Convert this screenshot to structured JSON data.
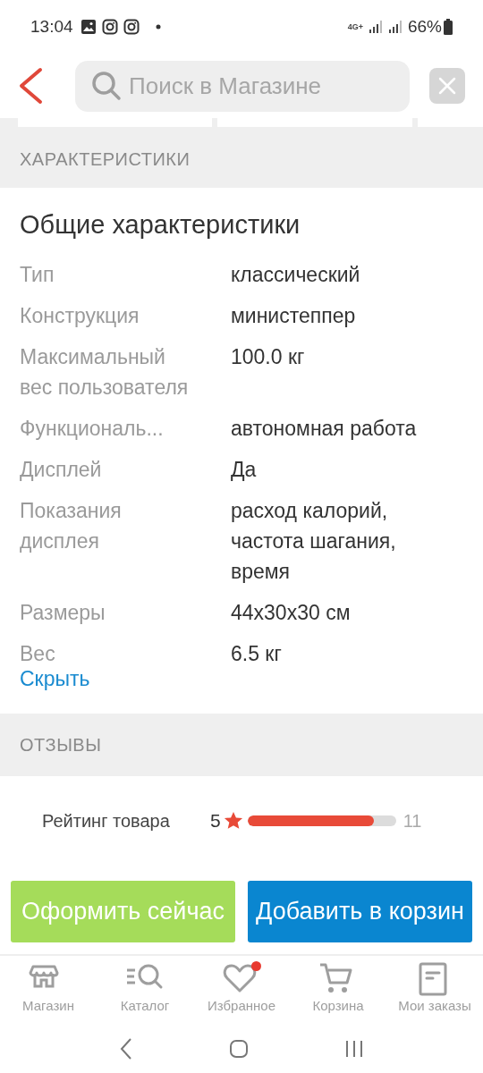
{
  "status_bar": {
    "time": "13:04",
    "network": "4G+",
    "battery": "66%"
  },
  "search": {
    "placeholder": "Поиск в Магазине"
  },
  "specs_section": {
    "heading": "ХАРАКТЕРИСТИКИ",
    "title": "Общие характеристики",
    "rows": [
      {
        "label": "Тип",
        "value": "классический"
      },
      {
        "label": "Конструкция",
        "value": "министеппер"
      },
      {
        "label": "Максимальный вес пользователя",
        "value": "100.0 кг"
      },
      {
        "label": "Функциональ...",
        "value": "автономная работа"
      },
      {
        "label": "Дисплей",
        "value": "Да"
      },
      {
        "label": "Показания дисплея",
        "value": "расход калорий, частота шагания, время"
      },
      {
        "label": "Размеры",
        "value": "44x30x30 см"
      },
      {
        "label": "Вес",
        "value": "6.5 кг"
      }
    ],
    "hide_link": "Скрыть"
  },
  "reviews_section": {
    "heading": "ОТЗЫВЫ",
    "rating_label": "Рейтинг товара",
    "rating_rows": [
      {
        "stars": "5",
        "level": 0.85,
        "count": "11"
      }
    ]
  },
  "actions": [
    {
      "label": "Оформить сейчас",
      "kind": "buy"
    },
    {
      "label": "Добавить в корзин",
      "kind": "cart"
    }
  ],
  "bottom_nav": [
    {
      "label": "Магазин",
      "kind": "store",
      "badge": false
    },
    {
      "label": "Каталог",
      "kind": "catalog",
      "badge": false
    },
    {
      "label": "Избранное",
      "kind": "favorites",
      "badge": true
    },
    {
      "label": "Корзина",
      "kind": "cart",
      "badge": false
    },
    {
      "label": "Мои заказы",
      "kind": "orders",
      "badge": false
    }
  ]
}
